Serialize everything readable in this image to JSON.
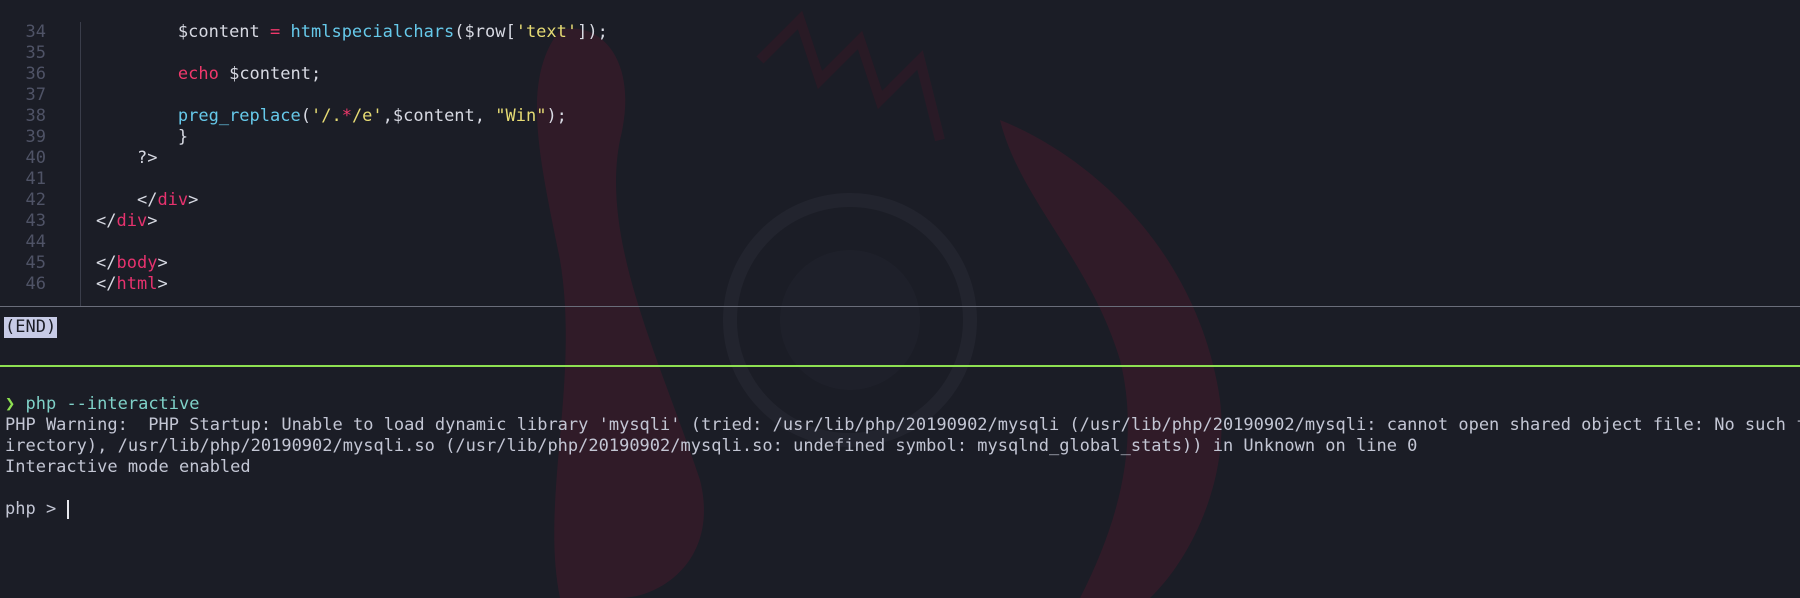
{
  "colors": {
    "background": "#1b1d26",
    "accent_green": "#8ee052",
    "keyword_pink": "#f0386b",
    "function_blue": "#66c9ea",
    "string_yellow": "#e6db74"
  },
  "editor": {
    "lines": [
      {
        "num": "34",
        "indent": "        ",
        "tokens": [
          {
            "t": "var",
            "v": "$content "
          },
          {
            "t": "op",
            "v": "="
          },
          {
            "t": "var",
            "v": " "
          },
          {
            "t": "fn",
            "v": "htmlspecialchars"
          },
          {
            "t": "punc",
            "v": "($row["
          },
          {
            "t": "str",
            "v": "'text'"
          },
          {
            "t": "punc",
            "v": "]);"
          }
        ]
      },
      {
        "num": "35",
        "indent": "",
        "tokens": []
      },
      {
        "num": "36",
        "indent": "        ",
        "tokens": [
          {
            "t": "kw",
            "v": "echo"
          },
          {
            "t": "var",
            "v": " $content;"
          }
        ]
      },
      {
        "num": "37",
        "indent": "",
        "tokens": []
      },
      {
        "num": "38",
        "indent": "        ",
        "tokens": [
          {
            "t": "fn",
            "v": "preg_replace"
          },
          {
            "t": "punc",
            "v": "("
          },
          {
            "t": "str",
            "v": "'/."
          },
          {
            "t": "op",
            "v": "*"
          },
          {
            "t": "str",
            "v": "/e'"
          },
          {
            "t": "punc",
            "v": ",$content, "
          },
          {
            "t": "str",
            "v": "\"Win\""
          },
          {
            "t": "punc",
            "v": ");"
          }
        ]
      },
      {
        "num": "39",
        "indent": "        ",
        "tokens": [
          {
            "t": "punc",
            "v": "}"
          }
        ]
      },
      {
        "num": "40",
        "indent": "    ",
        "tokens": [
          {
            "t": "punc",
            "v": "?>"
          }
        ]
      },
      {
        "num": "41",
        "indent": "",
        "tokens": []
      },
      {
        "num": "42",
        "indent": "    ",
        "tokens": [
          {
            "t": "punc",
            "v": "</"
          },
          {
            "t": "tag",
            "v": "div"
          },
          {
            "t": "punc",
            "v": ">"
          }
        ]
      },
      {
        "num": "43",
        "indent": "",
        "tokens": [
          {
            "t": "punc",
            "v": "</"
          },
          {
            "t": "tag",
            "v": "div"
          },
          {
            "t": "punc",
            "v": ">"
          }
        ]
      },
      {
        "num": "44",
        "indent": "",
        "tokens": []
      },
      {
        "num": "45",
        "indent": "",
        "tokens": [
          {
            "t": "punc",
            "v": "</"
          },
          {
            "t": "tag",
            "v": "body"
          },
          {
            "t": "punc",
            "v": ">"
          }
        ]
      },
      {
        "num": "46",
        "indent": "",
        "tokens": [
          {
            "t": "punc",
            "v": "</"
          },
          {
            "t": "tag",
            "v": "html"
          },
          {
            "t": "punc",
            "v": ">"
          }
        ]
      }
    ]
  },
  "pager": {
    "end_label": "(END)"
  },
  "terminal": {
    "prompt_symbol": "❯",
    "command": "php --interactive",
    "warning_line_1": "PHP Warning:  PHP Startup: Unable to load dynamic library 'mysqli' (tried: /usr/lib/php/20190902/mysqli (/usr/lib/php/20190902/mysqli: cannot open shared object file: No such file or d",
    "warning_line_2": "irectory), /usr/lib/php/20190902/mysqli.so (/usr/lib/php/20190902/mysqli.so: undefined symbol: mysqlnd_global_stats)) in Unknown on line 0",
    "mode_line": "Interactive mode enabled",
    "repl_prompt": "php > "
  }
}
